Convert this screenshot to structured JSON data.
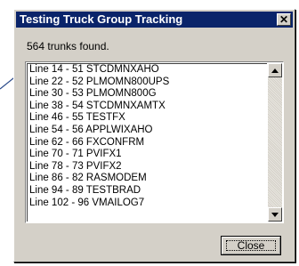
{
  "window": {
    "title": "Testing Truck Group Tracking",
    "close_glyph": "✕"
  },
  "status_text": "564 trunks found.",
  "list": {
    "items": [
      "Line 14 -  51 STCDMNXAHO",
      "Line 22 -  52 PLMOMN800UPS",
      "Line 30 -  53 PLMOMN800G",
      "Line 38 -  54 STCDMNXAMTX",
      "Line 46 -  55 TESTFX",
      "Line 54 -  56 APPLWIXAHO",
      "Line 62 -  66 FXCONFRM",
      "Line 70 -  71 PVIFX1",
      "Line 78 -  73 PVIFX2",
      "Line 86 -  82 RASMODEM",
      "Line 94 -  89 TESTBRAD",
      "Line 102 -  96 VMAILOG7"
    ]
  },
  "buttons": {
    "close_label": "Close"
  }
}
